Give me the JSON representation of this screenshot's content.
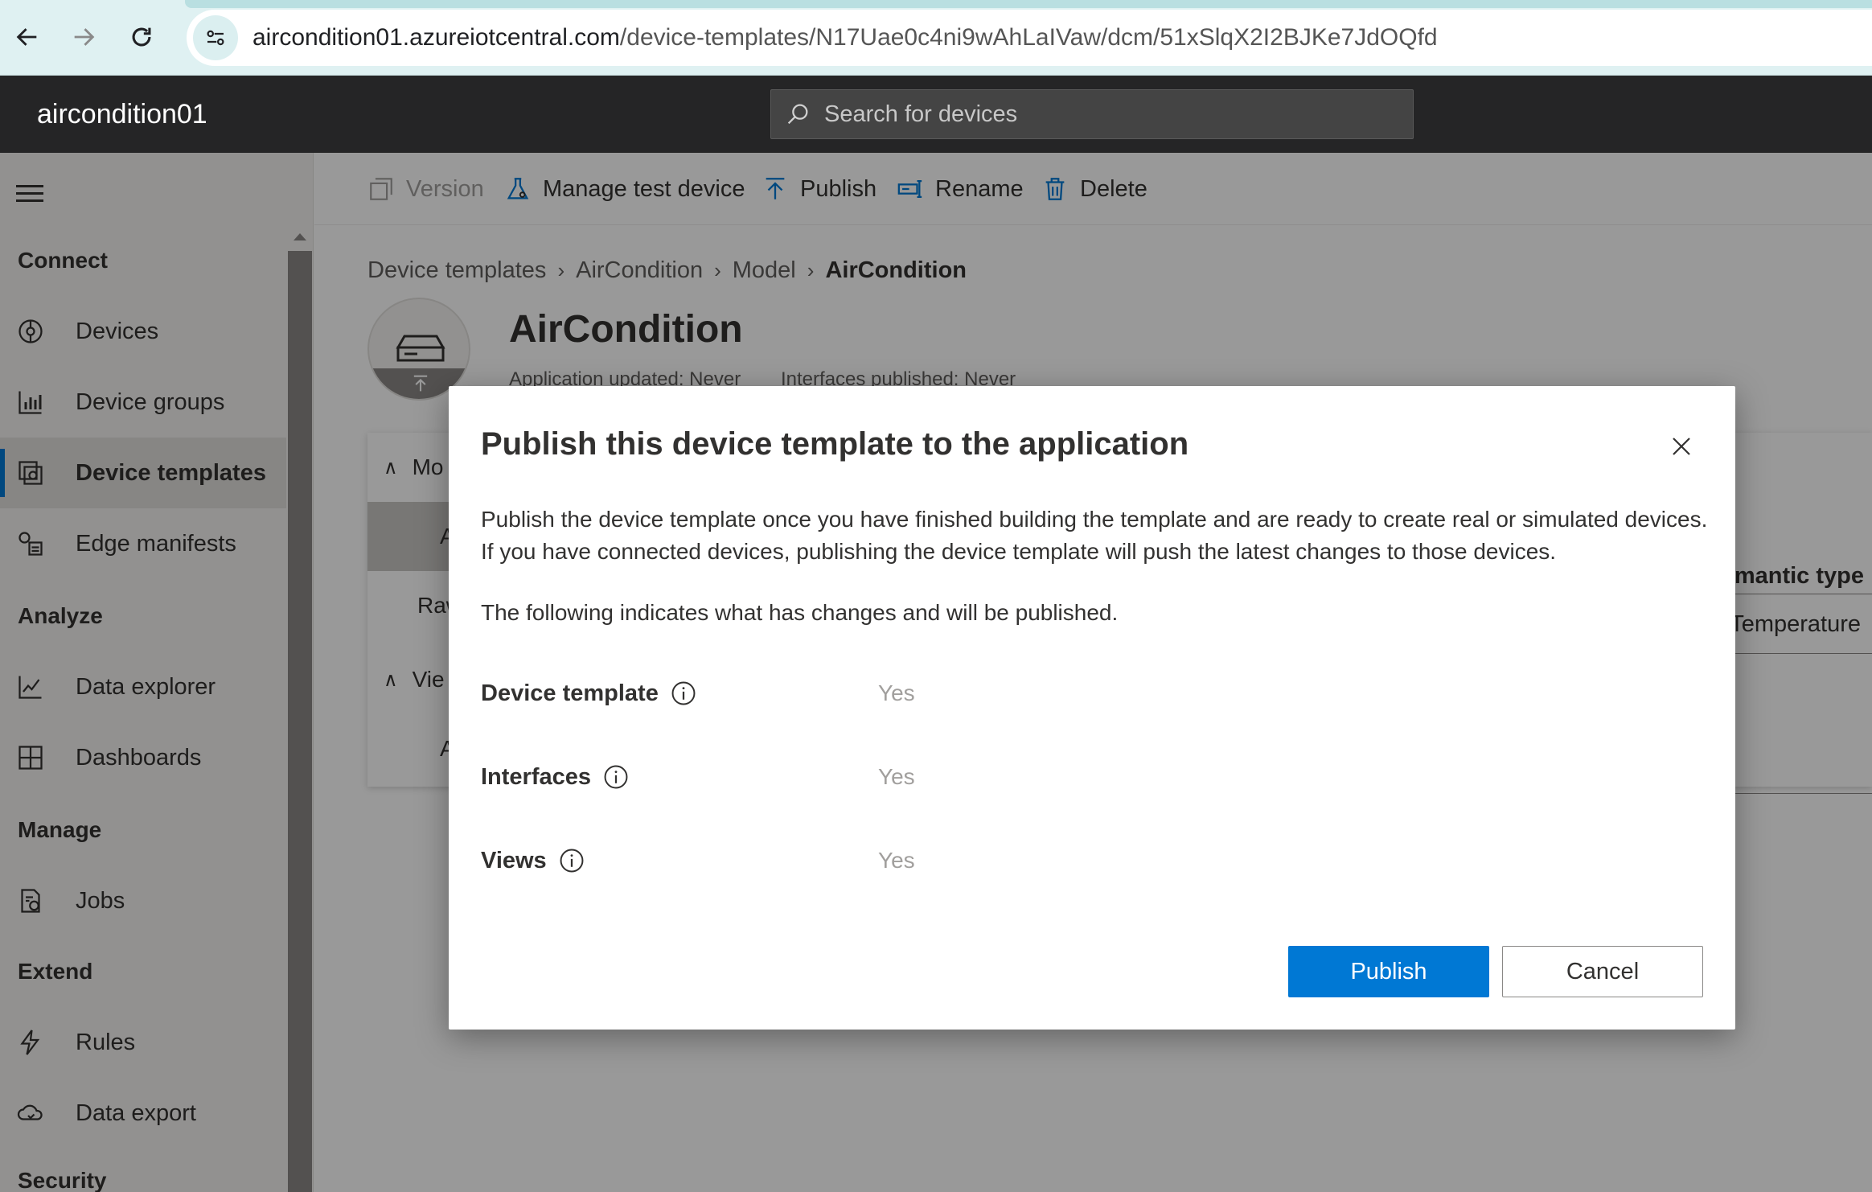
{
  "browser": {
    "url_host": "aircondition01.azureiotcentral.com",
    "url_path": "/device-templates/N17Uae0c4ni9wAhLaIVaw/dcm/51xSlqX2I2BJKe7JdOQfd",
    "icons": [
      "back-arrow-icon",
      "forward-arrow-icon",
      "reload-icon",
      "site-info-icon"
    ]
  },
  "header": {
    "app_name": "aircondition01",
    "search_placeholder": "Search for devices"
  },
  "sidebar": {
    "sections": [
      {
        "title": "Connect"
      },
      {
        "title": "Analyze"
      },
      {
        "title": "Manage"
      },
      {
        "title": "Extend"
      },
      {
        "title": "Security"
      }
    ],
    "items": [
      {
        "label": "Devices",
        "icon": "devices-icon"
      },
      {
        "label": "Device groups",
        "icon": "device-groups-icon"
      },
      {
        "label": "Device templates",
        "icon": "device-templates-icon",
        "active": true
      },
      {
        "label": "Edge manifests",
        "icon": "edge-manifests-icon"
      },
      {
        "label": "Data explorer",
        "icon": "data-explorer-icon"
      },
      {
        "label": "Dashboards",
        "icon": "dashboards-icon"
      },
      {
        "label": "Jobs",
        "icon": "jobs-icon"
      },
      {
        "label": "Rules",
        "icon": "rules-icon"
      },
      {
        "label": "Data export",
        "icon": "data-export-icon"
      }
    ]
  },
  "toolbar": {
    "version": "Version",
    "manage_test_device": "Manage test device",
    "publish": "Publish",
    "rename": "Rename",
    "delete": "Delete"
  },
  "breadcrumb": [
    "Device templates",
    "AirCondition",
    "Model",
    "AirCondition"
  ],
  "page": {
    "title": "AirCondition",
    "app_updated": "Application updated: Never",
    "interfaces_published": "Interfaces published: Never",
    "tree": [
      "Mo",
      "A",
      "Raw",
      "Vie",
      "A"
    ],
    "semantic_type_header": "emantic type",
    "semantic_type_value": "Temperature"
  },
  "dialog": {
    "title": "Publish this device template to the application",
    "description": "Publish the device template once you have finished building the template and are ready to create real or simulated devices. If you have connected devices, publishing the device template will push the latest changes to those devices.",
    "changes_intro": "The following indicates what has changes and will be published.",
    "rows": [
      {
        "label": "Device template",
        "value": "Yes"
      },
      {
        "label": "Interfaces",
        "value": "Yes"
      },
      {
        "label": "Views",
        "value": "Yes"
      }
    ],
    "publish_label": "Publish",
    "cancel_label": "Cancel"
  },
  "colors": {
    "accent": "#0078d4",
    "header_bg": "#252526",
    "browser_bg": "#dff1f2"
  }
}
